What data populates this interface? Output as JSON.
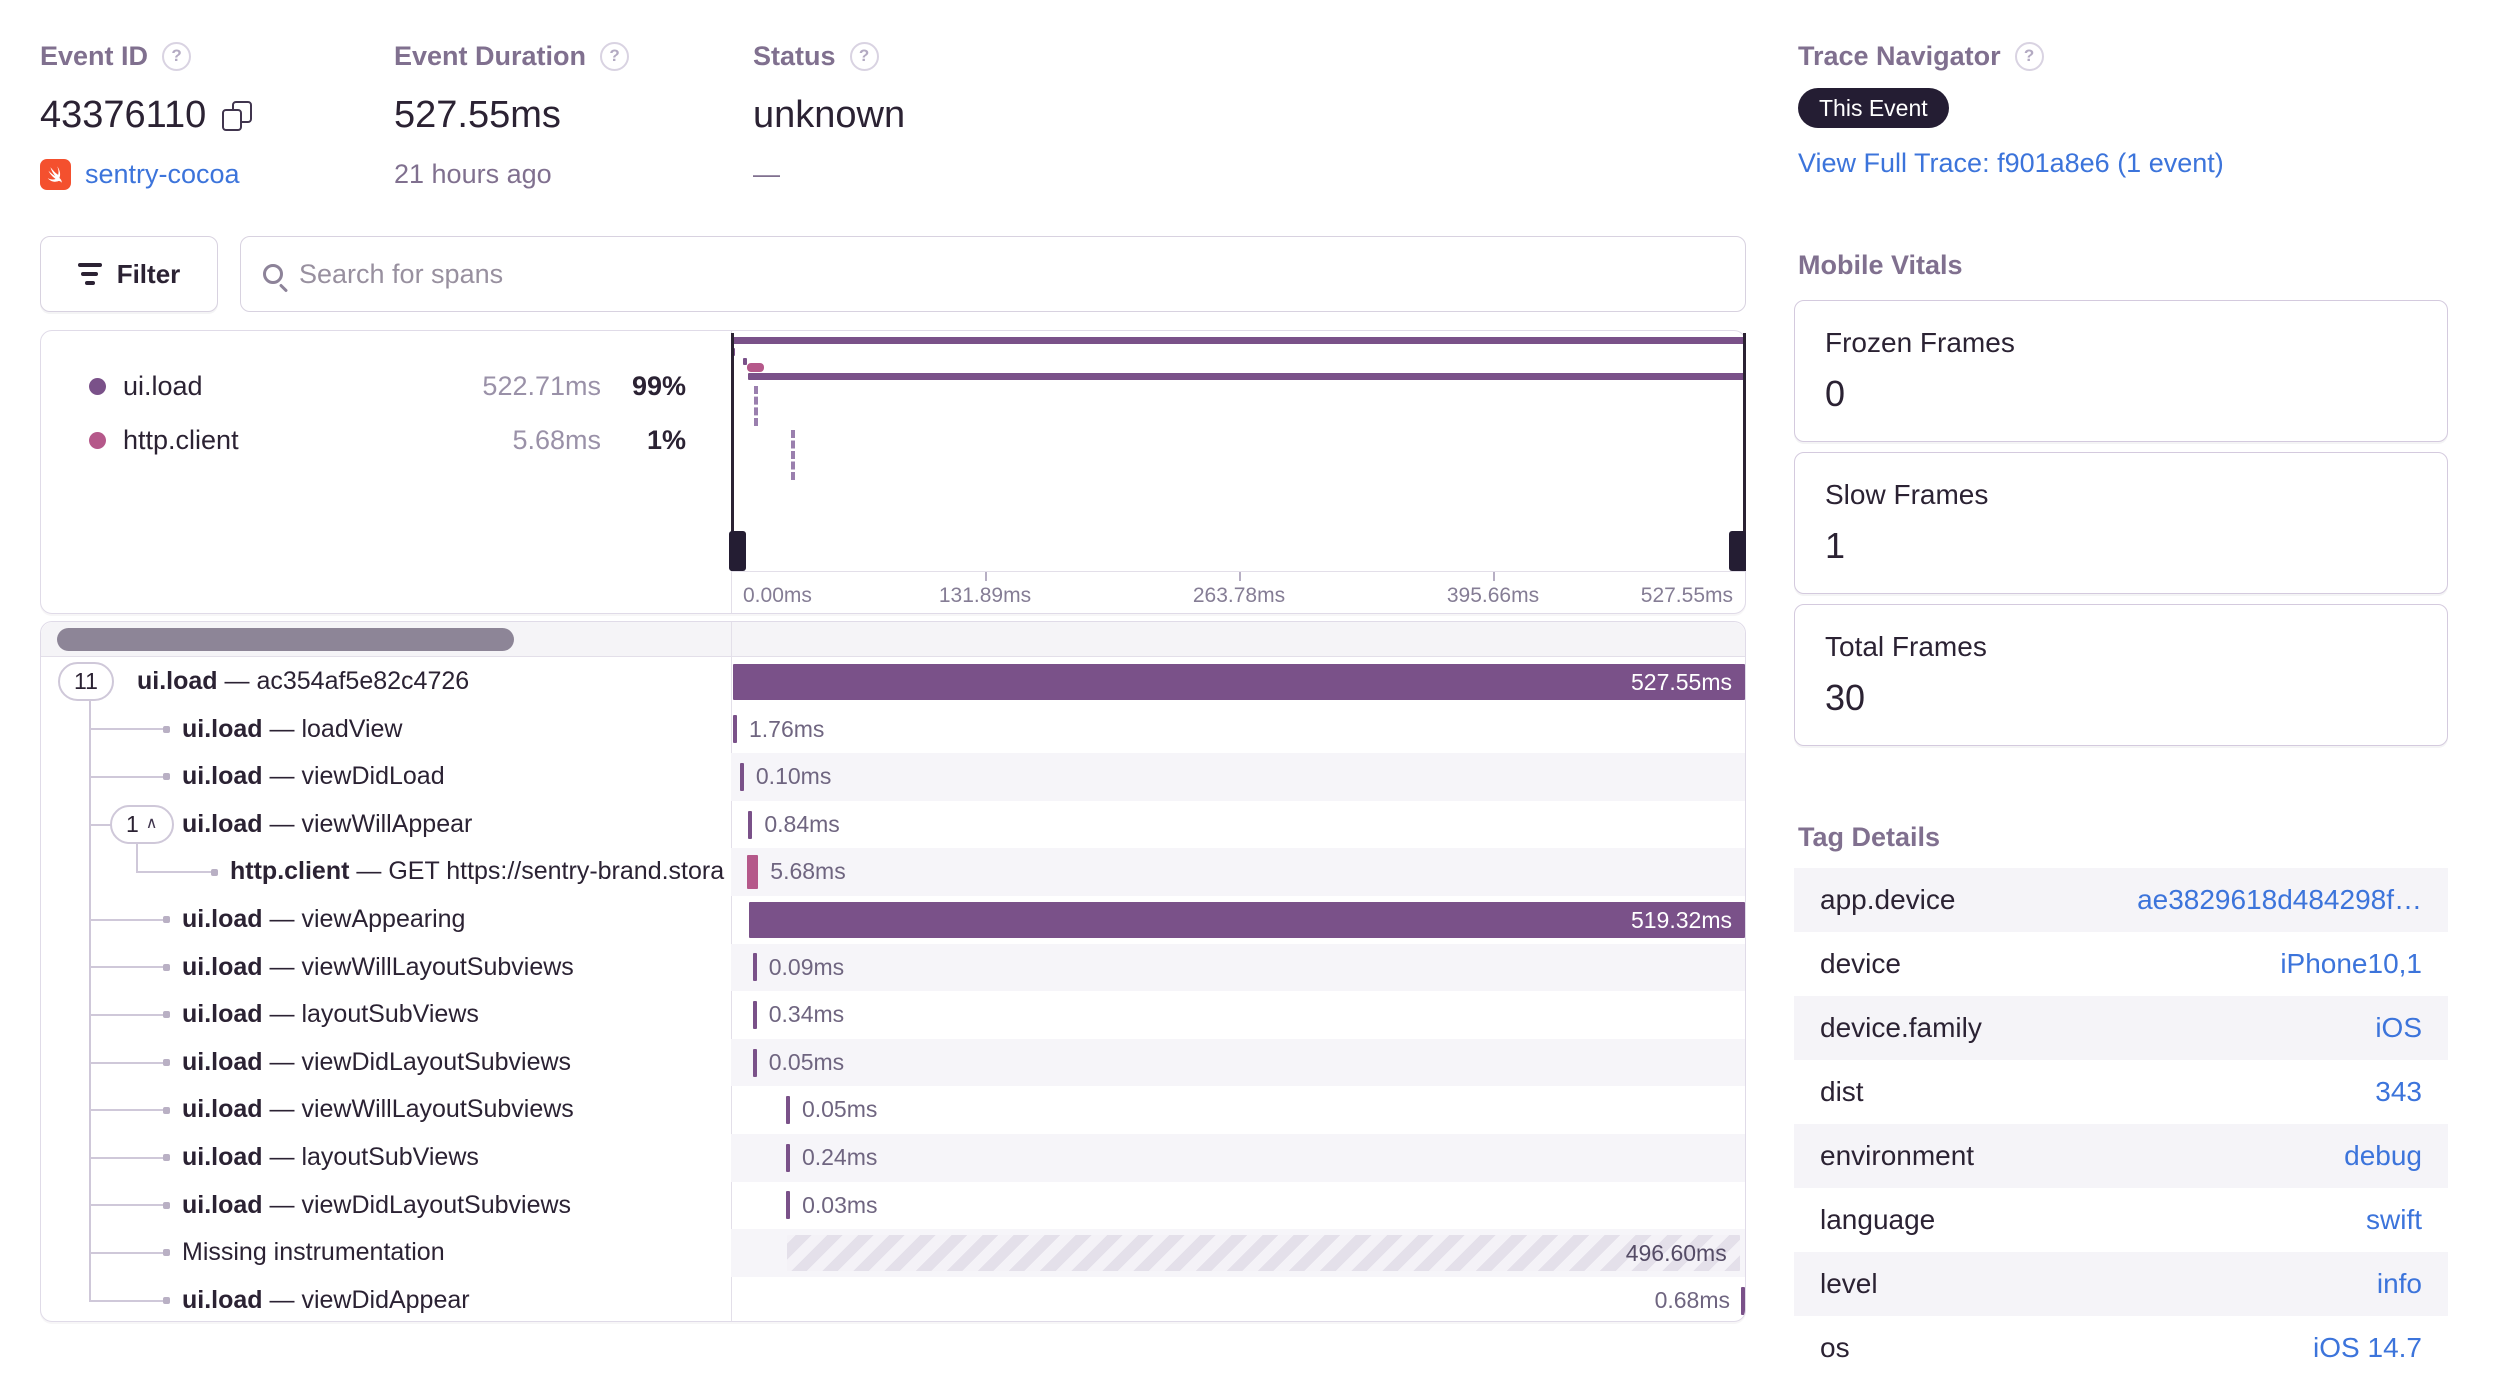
{
  "header": {
    "event_id": {
      "label": "Event ID",
      "value": "43376110",
      "project": "sentry-cocoa"
    },
    "event_duration": {
      "label": "Event Duration",
      "value": "527.55ms",
      "subtext": "21 hours ago"
    },
    "status": {
      "label": "Status",
      "value": "unknown",
      "subtext": "—"
    }
  },
  "trace": {
    "label": "Trace Navigator",
    "badge": "This Event",
    "link": "View Full Trace: f901a8e6 (1 event)"
  },
  "toolbar": {
    "filter_label": "Filter",
    "search_placeholder": "Search for spans"
  },
  "legend": [
    {
      "op": "ui.load",
      "duration": "522.71ms",
      "pct": "99%",
      "color": "#7a5189"
    },
    {
      "op": "http.client",
      "duration": "5.68ms",
      "pct": "1%",
      "color": "#b5588a"
    }
  ],
  "minimap": {
    "axis_labels": [
      "0.00ms",
      "131.89ms",
      "263.78ms",
      "395.66ms",
      "527.55ms"
    ],
    "total_ms": 527.55
  },
  "spans": [
    {
      "op": "ui.load",
      "desc": "ac354af5e82c4726",
      "count": "11",
      "depth": 0,
      "start_ms": 0,
      "dur_ms": 527.55,
      "label": "527.55ms",
      "kind": "ui",
      "label_pos": "inside-light"
    },
    {
      "op": "ui.load",
      "desc": "loadView",
      "depth": 1,
      "start_ms": 0,
      "dur_ms": 1.76,
      "label": "1.76ms",
      "kind": "ui",
      "label_pos": "after"
    },
    {
      "op": "ui.load",
      "desc": "viewDidLoad",
      "depth": 1,
      "start_ms": 3.6,
      "dur_ms": 0.1,
      "label": "0.10ms",
      "kind": "ui",
      "label_pos": "after"
    },
    {
      "op": "ui.load",
      "desc": "viewWillAppear",
      "count": "1",
      "chevron": true,
      "depth": 1,
      "start_ms": 8.0,
      "dur_ms": 0.84,
      "label": "0.84ms",
      "kind": "ui",
      "label_pos": "after"
    },
    {
      "op": "http.client",
      "desc": "GET https://sentry-brand.stora",
      "depth": 2,
      "start_ms": 7.5,
      "dur_ms": 5.68,
      "label": "5.68ms",
      "kind": "http",
      "label_pos": "after"
    },
    {
      "op": "ui.load",
      "desc": "viewAppearing",
      "depth": 1,
      "start_ms": 8.23,
      "dur_ms": 519.32,
      "label": "519.32ms",
      "kind": "ui",
      "label_pos": "inside-light"
    },
    {
      "op": "ui.load",
      "desc": "viewWillLayoutSubviews",
      "depth": 1,
      "start_ms": 10.3,
      "dur_ms": 0.09,
      "label": "0.09ms",
      "kind": "ui",
      "label_pos": "after"
    },
    {
      "op": "ui.load",
      "desc": "layoutSubViews",
      "depth": 1,
      "start_ms": 10.3,
      "dur_ms": 0.34,
      "label": "0.34ms",
      "kind": "ui",
      "label_pos": "after"
    },
    {
      "op": "ui.load",
      "desc": "viewDidLayoutSubviews",
      "depth": 1,
      "start_ms": 10.3,
      "dur_ms": 0.05,
      "label": "0.05ms",
      "kind": "ui",
      "label_pos": "after"
    },
    {
      "op": "ui.load",
      "desc": "viewWillLayoutSubviews",
      "depth": 1,
      "start_ms": 27.6,
      "dur_ms": 0.05,
      "label": "0.05ms",
      "kind": "ui",
      "label_pos": "after"
    },
    {
      "op": "ui.load",
      "desc": "layoutSubViews",
      "depth": 1,
      "start_ms": 27.6,
      "dur_ms": 0.24,
      "label": "0.24ms",
      "kind": "ui",
      "label_pos": "after"
    },
    {
      "op": "ui.load",
      "desc": "viewDidLayoutSubviews",
      "depth": 1,
      "start_ms": 27.7,
      "dur_ms": 0.03,
      "label": "0.03ms",
      "kind": "ui",
      "label_pos": "after"
    },
    {
      "op": null,
      "desc": "Missing instrumentation",
      "depth": 1,
      "start_ms": 28.2,
      "dur_ms": 496.6,
      "label": "496.60ms",
      "kind": "missing",
      "label_pos": "inside-dark"
    },
    {
      "op": "ui.load",
      "desc": "viewDidAppear",
      "depth": 1,
      "start_ms": 526.8,
      "dur_ms": 0.68,
      "label": "0.68ms",
      "kind": "ui",
      "label_pos": "before"
    }
  ],
  "headings": {
    "mobile_vitals": "Mobile Vitals",
    "tag_details": "Tag Details"
  },
  "vitals": [
    {
      "title": "Frozen Frames",
      "value": "0"
    },
    {
      "title": "Slow Frames",
      "value": "1"
    },
    {
      "title": "Total Frames",
      "value": "30"
    }
  ],
  "tags": [
    {
      "key": "app.device",
      "value": "ae3829618d484298f…"
    },
    {
      "key": "device",
      "value": "iPhone10,1"
    },
    {
      "key": "device.family",
      "value": "iOS"
    },
    {
      "key": "dist",
      "value": "343"
    },
    {
      "key": "environment",
      "value": "debug"
    },
    {
      "key": "language",
      "value": "swift"
    },
    {
      "key": "level",
      "value": "info"
    },
    {
      "key": "os",
      "value": "iOS 14.7"
    }
  ],
  "colors": {
    "purple": "#7a5189",
    "pink": "#b5588a",
    "link_blue": "#3c74db",
    "dark": "#2b2233"
  }
}
